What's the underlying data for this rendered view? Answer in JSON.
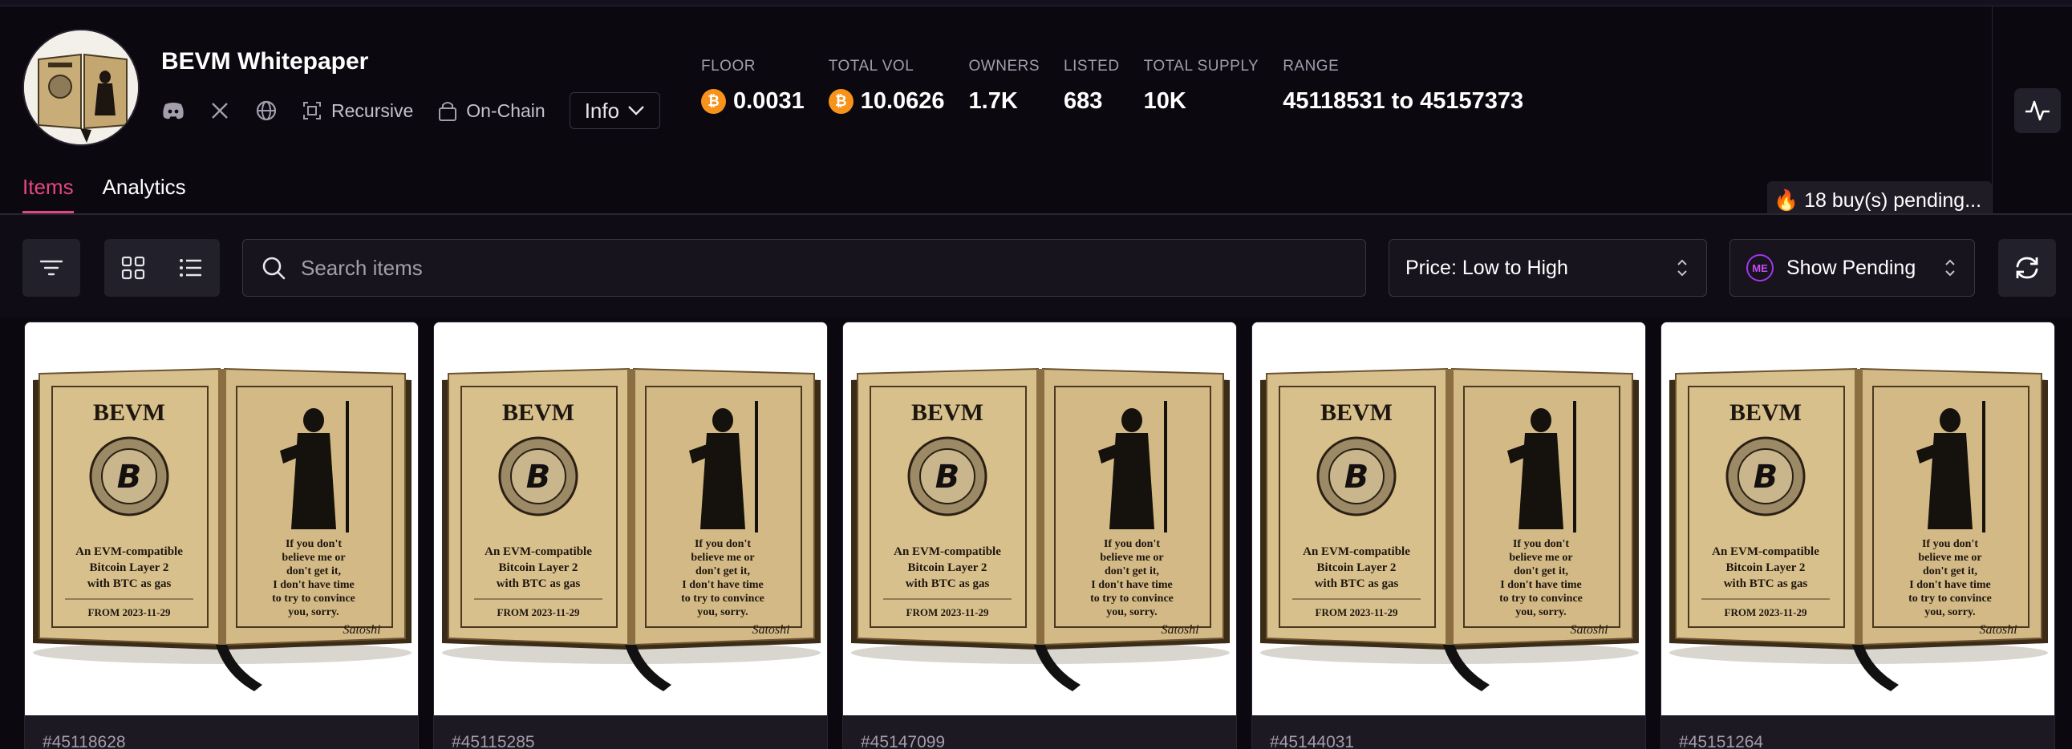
{
  "collection": {
    "name": "BEVM Whitepaper",
    "badges": {
      "recursive": "Recursive",
      "onchain": "On-Chain"
    },
    "info_label": "Info"
  },
  "stats": [
    {
      "label": "FLOOR",
      "value": "0.0031",
      "btc": true
    },
    {
      "label": "TOTAL VOL",
      "value": "10.0626",
      "btc": true
    },
    {
      "label": "OWNERS",
      "value": "1.7K",
      "btc": false
    },
    {
      "label": "LISTED",
      "value": "683",
      "btc": false
    },
    {
      "label": "TOTAL SUPPLY",
      "value": "10K",
      "btc": false
    },
    {
      "label": "RANGE",
      "value": "45118531 to 45157373",
      "btc": false
    }
  ],
  "tabs": {
    "items": "Items",
    "analytics": "Analytics"
  },
  "pending_notice": "🔥 18 buy(s) pending...",
  "toolbar": {
    "search_placeholder": "Search items",
    "sort": "Price: Low to High",
    "pending_filter": "Show Pending"
  },
  "book_text": {
    "title": "BEVM",
    "left": [
      "An EVM-compatible",
      "Bitcoin Layer 2",
      "with BTC as gas"
    ],
    "date": "FROM 2023-11-29",
    "right": [
      "If you don't",
      "believe me or",
      "don't get it,",
      "I don't have time",
      "to try to convince",
      "you, sorry."
    ],
    "signature": "Satoshi"
  },
  "cards": [
    {
      "id": "#45118628"
    },
    {
      "id": "#45115285"
    },
    {
      "id": "#45147099"
    },
    {
      "id": "#45144031"
    },
    {
      "id": "#45151264"
    }
  ],
  "colors": {
    "background": "#0b080f",
    "accent": "#e4477f",
    "btc": "#f7931a",
    "panel": "#22202a"
  },
  "icons": [
    "discord-icon",
    "x-icon",
    "globe-icon",
    "recursive-icon",
    "onchain-icon",
    "filter-icon",
    "grid-view-icon",
    "list-view-icon",
    "search-icon",
    "activity-icon",
    "refresh-icon"
  ]
}
